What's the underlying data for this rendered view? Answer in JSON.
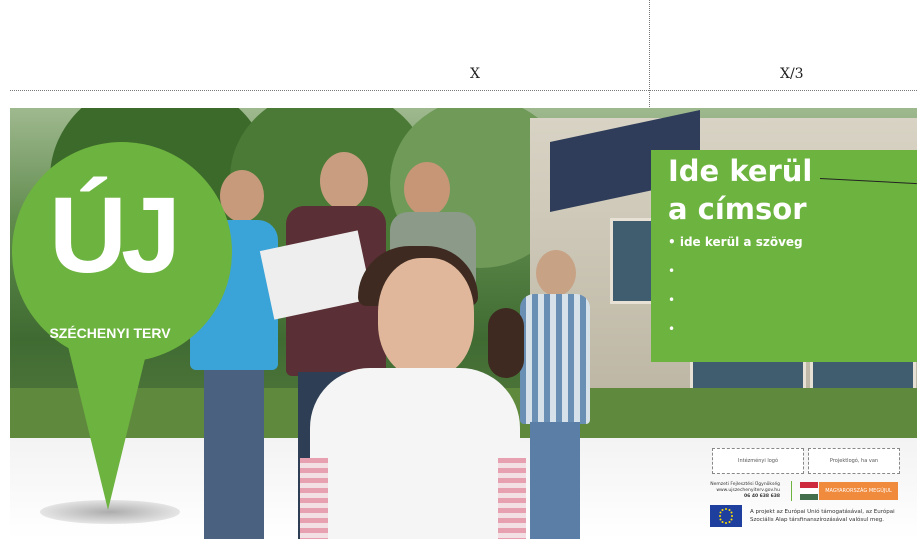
{
  "dimensions": {
    "x_label": "X",
    "x3_label": "X/3"
  },
  "logo": {
    "uj": "ÚJ",
    "subtitle": "SZÉCHENYI TERV"
  },
  "panel": {
    "headline_line1": "Ide kerül",
    "headline_line2": "a címsor",
    "bullets": [
      "• ide kerül a szöveg",
      "•",
      "•",
      "•"
    ]
  },
  "footer": {
    "institution_logo": "Intézményi logó",
    "project_logo": "Projektlogó, ha van",
    "agency_name": "Nemzeti Fejlesztési Ügynökség",
    "agency_url": "www.ujszechenyiterv.gov.hu",
    "agency_phone": "06 40 638 638",
    "orange_label": "MAGYARORSZÁG MEGÚJUL",
    "eu_text": "A projekt az Európai Unió támogatásával, az Európai Szociális Alap társfinanszírozásával valósul meg."
  },
  "colors": {
    "brand_green": "#6db33f",
    "orange": "#f08a3c",
    "eu_blue": "#1f3f9f"
  }
}
